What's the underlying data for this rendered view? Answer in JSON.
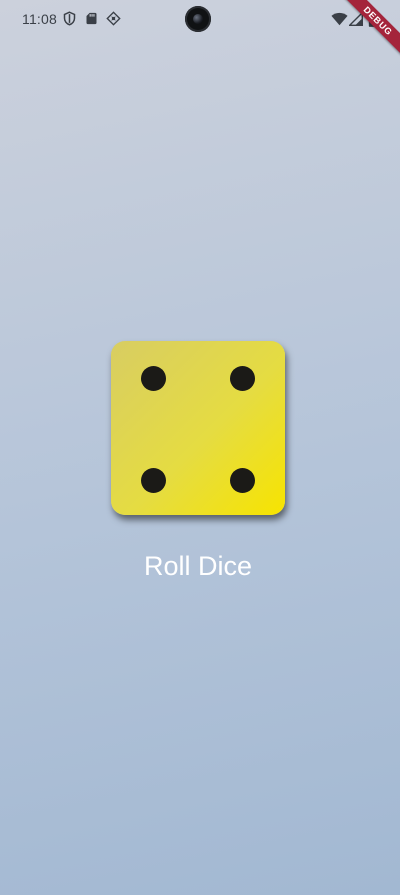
{
  "status_bar": {
    "time": "11:08",
    "left_icons": [
      "shield-icon",
      "sd-card-icon",
      "vpn-key-icon"
    ],
    "right_icons": [
      "wifi-icon",
      "cell-signal-icon",
      "battery-icon"
    ]
  },
  "debug_banner": {
    "label": "DEBUG",
    "color": "#a4243b"
  },
  "dice": {
    "face_value": 4,
    "face_color_start": "#d8cd62",
    "face_color_end": "#f7e400",
    "pip_color": "#1b1a17"
  },
  "roll_button": {
    "label": "Roll Dice",
    "text_color": "#ffffff"
  },
  "background": {
    "gradient_top": "#ccd1dc",
    "gradient_bottom": "#a2b8d2"
  }
}
